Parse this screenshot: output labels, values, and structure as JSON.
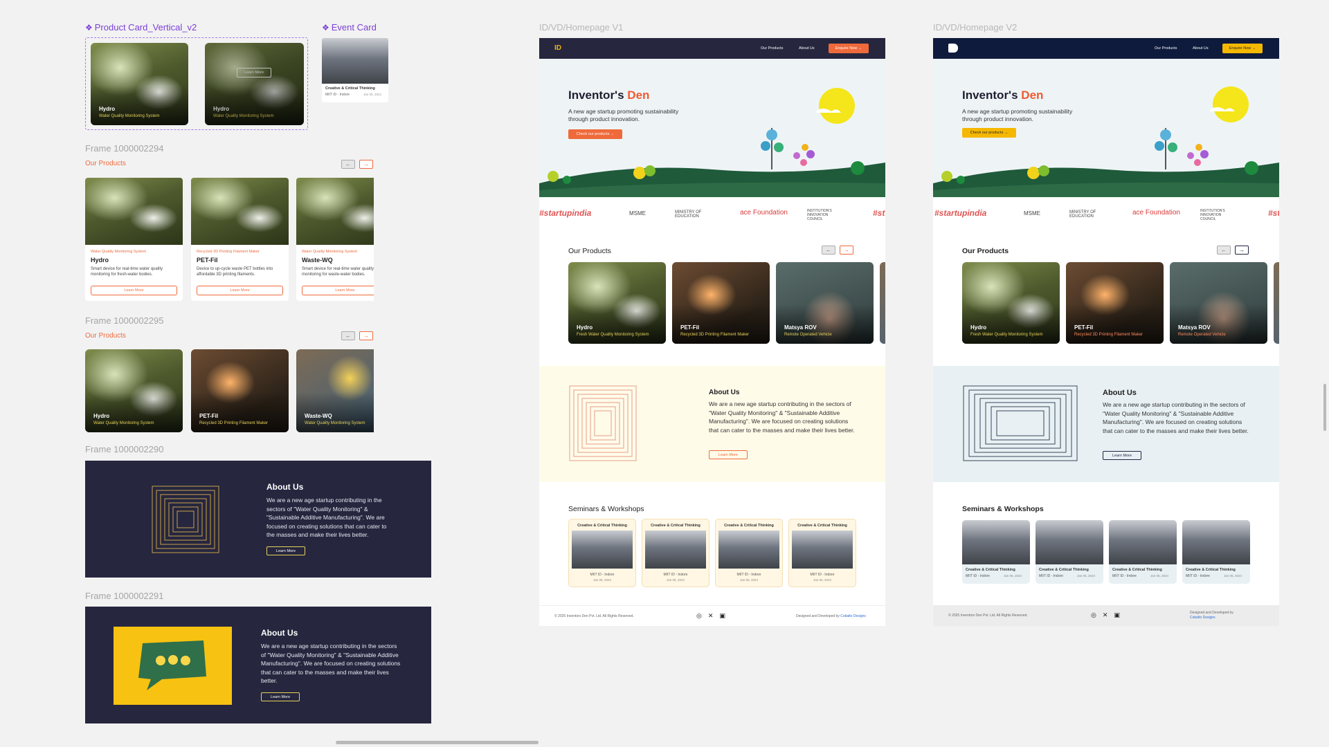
{
  "canvas": {
    "bg": "#f2f2f2",
    "accent_orange": "#ef6a3b",
    "accent_yellow": "#f5b800",
    "navy": "#26263f"
  },
  "components": {
    "product_card_label": "Product Card_Vertical_v2",
    "event_card_label": "Event Card",
    "product_card_a": {
      "name": "Hydro",
      "sub": "Water Quality Monitoring System"
    },
    "product_card_b": {
      "name": "Hydro",
      "sub": "Water Quality Monitoring System",
      "hover_label": "Learn More"
    },
    "event_card": {
      "title": "Creative & Critical Thinking",
      "place": "MIIT ID - Indore",
      "date": "Jan 05, 2024"
    }
  },
  "frame_2294": {
    "label": "Frame 1000002294",
    "title": "Our Products",
    "prev": "←",
    "next": "→",
    "cards": [
      {
        "cat": "Water Quality Monitoring System",
        "name": "Hydro",
        "desc": "Smart device for real-time water quality monitoring for fresh-water bodies.",
        "btn": "Learn More"
      },
      {
        "cat": "Recycled 3D Printing Filament Maker",
        "name": "PET-Fil",
        "desc": "Device to up-cycle waste PET bottles into affordable 3D printing filaments.",
        "btn": "Learn More"
      },
      {
        "cat": "Water Quality Monitoring System",
        "name": "Waste-WQ",
        "desc": "Smart device for real-time water quality monitoring for waste-water bodies.",
        "btn": "Learn More"
      }
    ]
  },
  "frame_2295": {
    "label": "Frame 1000002295",
    "title": "Our Products",
    "prev": "←",
    "next": "→",
    "cards": [
      {
        "name": "Hydro",
        "sub": "Water Quality Monitoring System"
      },
      {
        "name": "PET-Fil",
        "sub": "Recycled 3D Printing Filament Maker"
      },
      {
        "name": "Waste-WQ",
        "sub": "Water Quality Monitoring System"
      }
    ]
  },
  "frame_2290": {
    "label": "Frame 1000002290",
    "title": "About Us",
    "text": "We are a new age startup contributing in the sectors of \"Water Quality Monitoring\" & \"Sustainable Additive Manufacturing\". We are focused on creating solutions that can cater to the masses and make their lives better.",
    "btn": "Learn More"
  },
  "frame_2291": {
    "label": "Frame 1000002291",
    "title": "About Us",
    "text": "We are a new age startup contributing in the sectors of \"Water Quality Monitoring\" & \"Sustainable Additive Manufacturing\". We are focused on creating solutions that can cater to the masses and make their lives better.",
    "btn": "Learn More"
  },
  "v1": {
    "label": "ID/VD/Homepage V1",
    "logo": "ID",
    "nav": [
      "Our Products",
      "About Us"
    ],
    "enquire": "Enquire Now",
    "hero_title_a": "Inventor's ",
    "hero_title_b": "Den",
    "hero_sub": "A new age startup promoting sustainability through product innovation.",
    "hero_btn": "Check our products",
    "hashtag": "#startupindia",
    "hashtag_cut": "#st",
    "logos": [
      "MSME",
      "MINISTRY OF EDUCATION",
      "ace Foundation",
      "INSTITUTION'S INNOVATION COUNCIL"
    ],
    "products_title": "Our Products",
    "prev": "←",
    "next": "→",
    "products": [
      {
        "name": "Hydro",
        "sub": "Fresh Water Quality Monitoring System"
      },
      {
        "name": "PET-Fil",
        "sub": "Recycled 3D Printing Filament Maker"
      },
      {
        "name": "Matsya ROV",
        "sub": "Remote Operated Vehicle"
      }
    ],
    "about_title": "About Us",
    "about_text": "We are a new age startup contributing in the sectors of \"Water Quality Monitoring\" & \"Sustainable Additive Manufacturing\". We are focused on creating solutions that can cater to the masses and make their lives better.",
    "about_btn": "Learn More",
    "seminars_title": "Seminars & Workshops",
    "events": [
      {
        "title": "Creative & Critical Thinking",
        "place": "MIIT ID - Indore",
        "date": "Jan 05, 2024"
      },
      {
        "title": "Creative & Critical Thinking",
        "place": "MIIT ID - Indore",
        "date": "Jan 05, 2024"
      },
      {
        "title": "Creative & Critical Thinking",
        "place": "MIIT ID - Indore",
        "date": "Jan 05, 2024"
      },
      {
        "title": "Creative & Critical Thinking",
        "place": "MIIT ID - Indore",
        "date": "Jan 05, 2024"
      }
    ],
    "copyright": "© 2025 Inventors Den Pvt. Ltd. All Rights Reserved.",
    "designed": "Designed and Developed by ",
    "designer": "Cobalto Designs"
  },
  "v2": {
    "label": "ID/VD/Homepage V2",
    "nav": [
      "Our Products",
      "About Us"
    ],
    "enquire": "Enquire Now",
    "hero_title_a": "Inventor's ",
    "hero_title_b": "Den",
    "hero_sub": "A new age startup promoting sustainability through product innovation.",
    "hero_btn": "Check our products",
    "hashtag": "#startupindia",
    "hashtag_cut": "#st",
    "logos": [
      "MSME",
      "MINISTRY OF EDUCATION",
      "ace Foundation",
      "INSTITUTION'S INNOVATION COUNCIL"
    ],
    "products_title": "Our Products",
    "prev": "←",
    "next": "→",
    "products": [
      {
        "name": "Hydro",
        "sub": "Fresh Water Quality Monitoring System"
      },
      {
        "name": "PET-Fil",
        "sub": "Recycled 3D Printing Filament Maker"
      },
      {
        "name": "Matsya ROV",
        "sub": "Remote Operated Vehicle"
      }
    ],
    "about_title": "About Us",
    "about_text": "We are a new age startup contributing in the sectors of \"Water Quality Monitoring\" & \"Sustainable Additive Manufacturing\". We are focused on creating solutions that can cater to the masses and make their lives better.",
    "about_btn": "Learn More",
    "seminars_title": "Seminars & Workshops",
    "events": [
      {
        "title": "Creative & Critical Thinking",
        "place": "MIIT ID - Indore",
        "date": "Jan 05, 2024"
      },
      {
        "title": "Creative & Critical Thinking",
        "place": "MIIT ID - Indore",
        "date": "Jan 05, 2024"
      },
      {
        "title": "Creative & Critical Thinking",
        "place": "MIIT ID - Indore",
        "date": "Jan 05, 2024"
      },
      {
        "title": "Creative & Critical Thinking",
        "place": "MIIT ID - Indore",
        "date": "Jan 05, 2024"
      }
    ],
    "copyright": "© 2025 Inventors Den Pvt. Ltd. All Rights Reserved.",
    "designed": "Designed and Developed by ",
    "designer": "Cobalto Designs"
  }
}
